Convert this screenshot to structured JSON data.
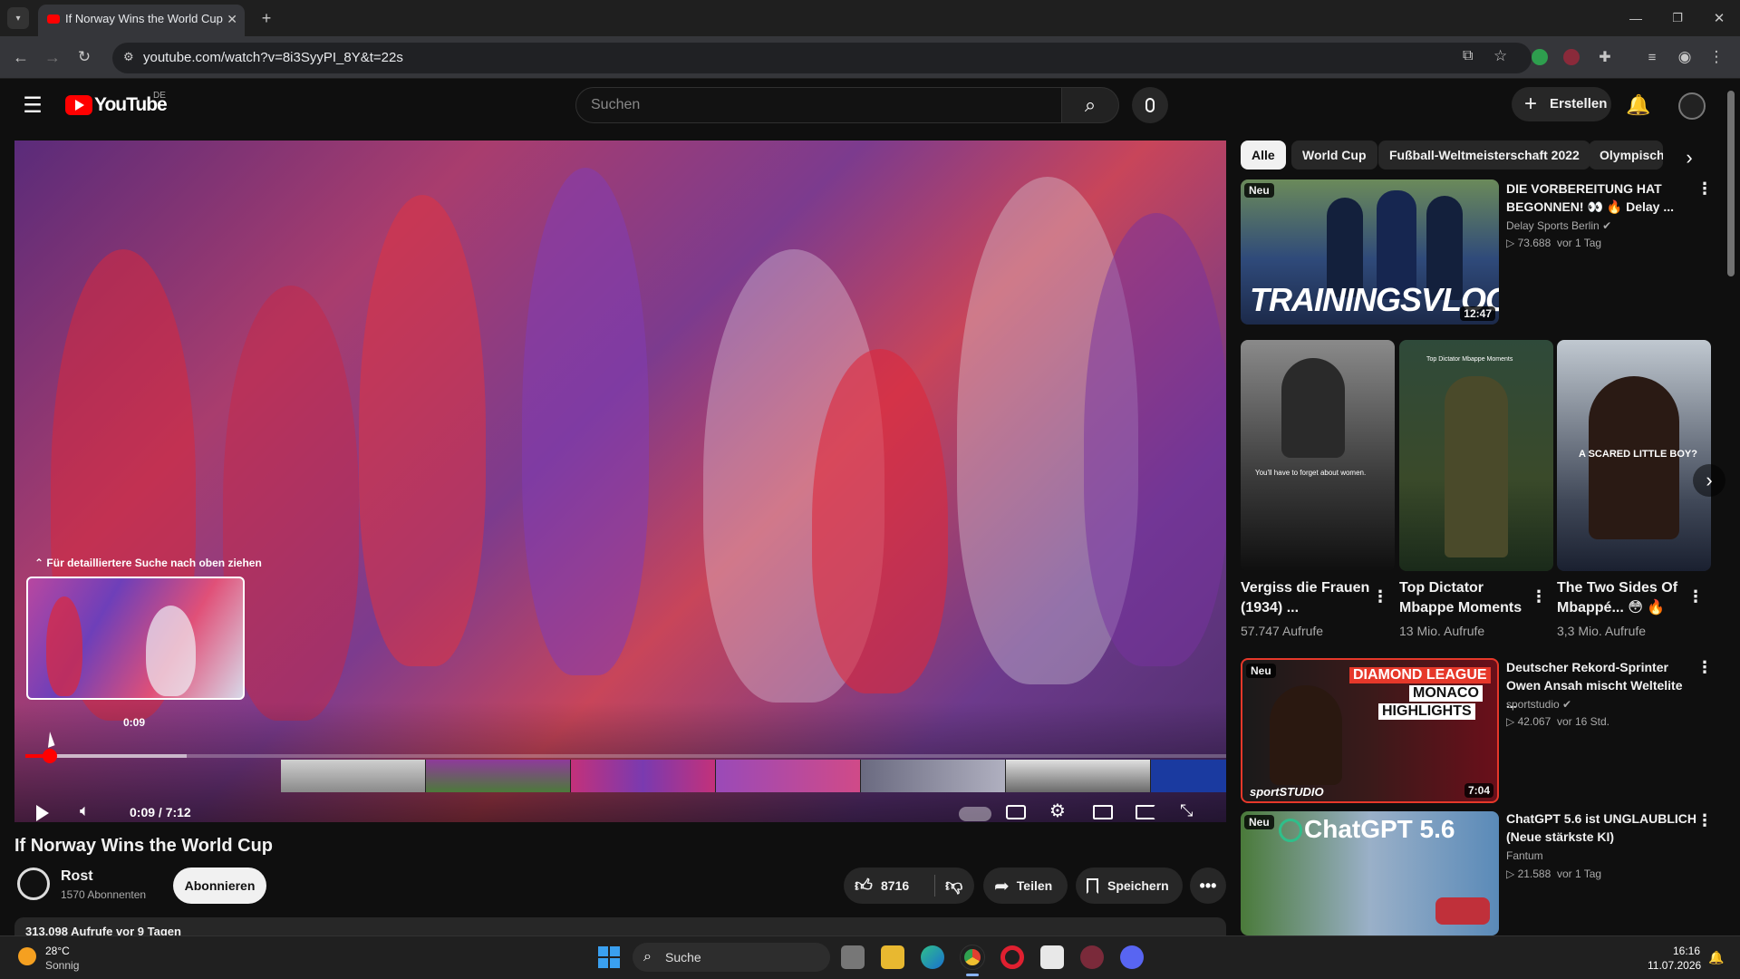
{
  "browser": {
    "tab_title": "If Norway Wins the World Cup",
    "url": "youtube.com/watch?v=8i3SyyPI_8Y&t=22s"
  },
  "youtube": {
    "logo_text": "YouTube",
    "region": "DE",
    "search_placeholder": "Suchen",
    "create_label": "Erstellen"
  },
  "player": {
    "hint": "Für detailliertere Suche nach oben ziehen",
    "preview_time": "0:09",
    "time_display": "0:09 / 7:12",
    "progress_fraction": 0.02
  },
  "video": {
    "title": "If Norway Wins the World Cup",
    "channel": "Rost",
    "subscribers": "1570 Abonnenten",
    "subscribe_label": "Abonnieren",
    "likes": "8716",
    "share_label": "Teilen",
    "save_label": "Speichern",
    "views_date": "313.098 Aufrufe  vor 9 Tagen"
  },
  "chips": [
    "Alle",
    "World Cup",
    "Fußball-Weltmeisterschaft 2022",
    "Olympisch"
  ],
  "recommendations": [
    {
      "badge": "Neu",
      "title_line1": "DIE VORBEREITUNG HAT",
      "title_line2": "BEGONNEN! 👀 🔥 Delay ...",
      "channel": "Delay Sports Berlin",
      "views": "73.688",
      "age": "vor 1 Tag",
      "duration": "12:47",
      "thumb_text": "TRAININGSVLOG"
    },
    {
      "badge": "Neu",
      "title_line1": "Deutscher Rekord-Sprinter",
      "title_line2": "Owen Ansah mischt Weltelite ...",
      "channel": "sportstudio",
      "views": "42.067",
      "age": "vor 16 Std.",
      "duration": "7:04",
      "thumb_text_1": "DIAMOND LEAGUE",
      "thumb_text_2": "MONACO",
      "thumb_text_3": "HIGHLIGHTS",
      "thumb_brand": "sportSTUDIO"
    },
    {
      "badge": "Neu",
      "title_line1": "ChatGPT 5.6 ist UNGLAUBLICH",
      "title_line2": "(Neue stärkste KI)",
      "channel": "Fantum",
      "views": "21.588",
      "age": "vor 1 Tag",
      "thumb_text": "ChatGPT 5.6"
    }
  ],
  "shorts": [
    {
      "title_line1": "Vergiss die Frauen",
      "title_line2": "(1934) ...",
      "views": "57.747 Aufrufe",
      "caption": "You'll have to forget about women."
    },
    {
      "title_line1": "Top Dictator",
      "title_line2": "Mbappe Moments",
      "views": "13 Mio. Aufrufe",
      "caption": "Top Dictator Mbappe Moments"
    },
    {
      "title_line1": "The Two Sides Of",
      "title_line2": "Mbappé... 😳 🔥",
      "views": "3,3 Mio. Aufrufe",
      "caption": "A SCARED LITTLE BOY?"
    }
  ],
  "taskbar": {
    "weather_temp": "28°C",
    "weather_desc": "Sonnig",
    "search_label": "Suche",
    "time": "16:16",
    "date": "11.07.2026"
  },
  "colors": {
    "accent": "#ff0000",
    "bg": "#0f0f0f"
  }
}
